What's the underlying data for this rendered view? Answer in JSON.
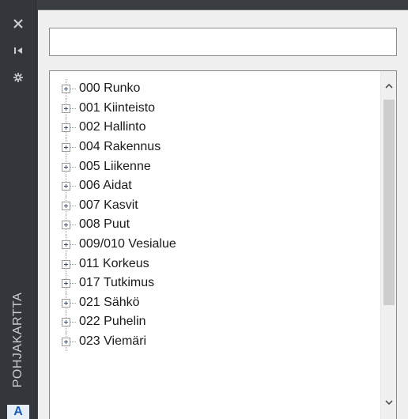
{
  "strip": {
    "title": "POHJAKARTTA",
    "app_letter": "A",
    "buttons": [
      "close-icon",
      "pin-icon",
      "settings-icon"
    ]
  },
  "search": {
    "value": "",
    "placeholder": ""
  },
  "tree": {
    "items": [
      {
        "label": "000 Runko"
      },
      {
        "label": "001 Kiinteisto"
      },
      {
        "label": "002 Hallinto"
      },
      {
        "label": "004 Rakennus"
      },
      {
        "label": "005 Liikenne"
      },
      {
        "label": "006 Aidat"
      },
      {
        "label": "007 Kasvit"
      },
      {
        "label": "008 Puut"
      },
      {
        "label": "009/010 Vesialue"
      },
      {
        "label": "011 Korkeus"
      },
      {
        "label": "017 Tutkimus"
      },
      {
        "label": "021 Sähkö"
      },
      {
        "label": "022 Puhelin"
      },
      {
        "label": "023 Viemäri"
      }
    ]
  },
  "colors": {
    "strip_bg": "#33363a",
    "panel_bg": "#f0f0f0",
    "accent": "#1a5fb4"
  }
}
